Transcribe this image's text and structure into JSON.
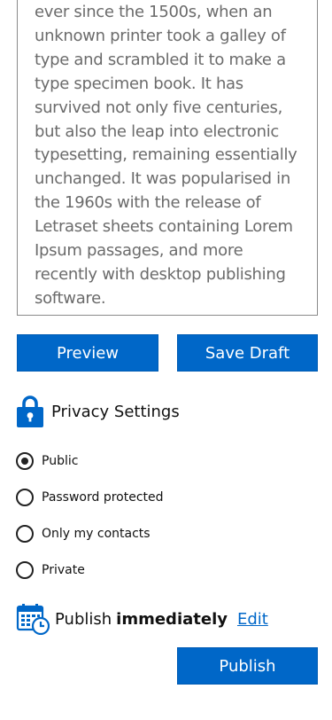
{
  "editor": {
    "body_text": "ever since the 1500s, when an\nunknown printer took a galley of\ntype and scrambled it to make a\ntype specimen book. It has\nsurvived not only five centuries,\nbut also the leap into electronic\ntypesetting, remaining essentially\nunchanged. It was popularised in\nthe 1960s with the release of\nLetraset sheets containing Lorem\nIpsum passages, and more\nrecently with desktop publishing\nsoftware."
  },
  "actions": {
    "preview_label": "Preview",
    "save_draft_label": "Save Draft"
  },
  "privacy": {
    "title": "Privacy Settings",
    "icon": "lock-icon",
    "options": [
      {
        "label": "Public",
        "selected": true
      },
      {
        "label": "Password protected",
        "selected": false
      },
      {
        "label": "Only my contacts",
        "selected": false
      },
      {
        "label": "Private",
        "selected": false
      }
    ]
  },
  "publish": {
    "icon": "calendar-clock-icon",
    "prefix": "Publish",
    "timing": "immediately",
    "edit_label": "Edit",
    "button_label": "Publish"
  },
  "colors": {
    "accent": "#0067c8",
    "border": "#8a8a8a",
    "muted_text": "#6b6b6b"
  }
}
